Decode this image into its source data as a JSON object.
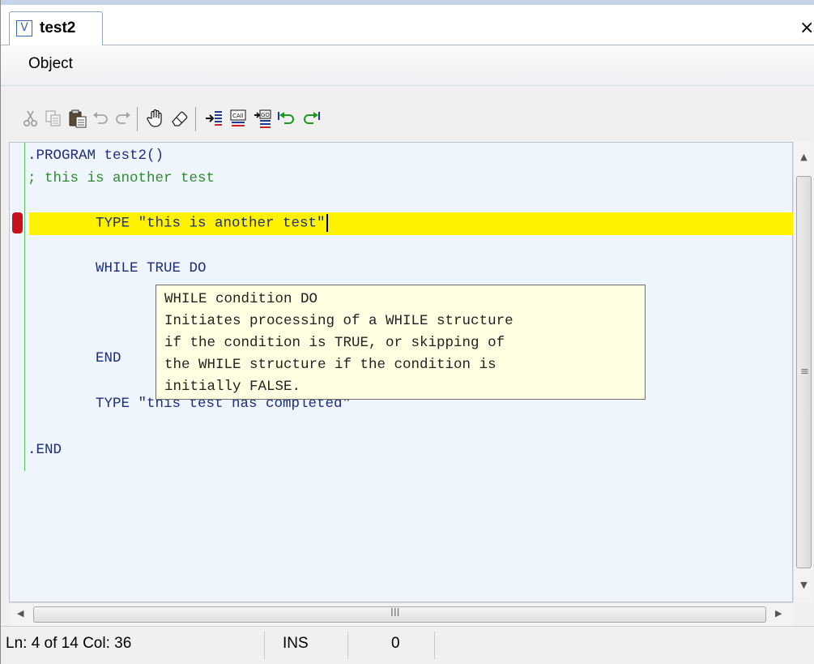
{
  "window": {
    "tab_icon_glyph": "V",
    "tab_title": "test2",
    "close_glyph": "×"
  },
  "menu": {
    "items": [
      "Object"
    ]
  },
  "toolbar": {
    "buttons": [
      {
        "icon": "cut-icon",
        "enabled": false
      },
      {
        "icon": "copy-icon",
        "enabled": false
      },
      {
        "icon": "paste-icon",
        "enabled": true
      },
      {
        "icon": "undo-icon",
        "enabled": false
      },
      {
        "icon": "redo-icon",
        "enabled": false
      },
      {
        "icon": "hand-icon",
        "enabled": true
      },
      {
        "icon": "eraser-icon",
        "enabled": true
      },
      {
        "icon": "step-into-icon",
        "enabled": true
      },
      {
        "icon": "call-icon",
        "enabled": true
      },
      {
        "icon": "go-icon",
        "enabled": true
      },
      {
        "icon": "step-back-icon",
        "enabled": true
      },
      {
        "icon": "step-forward-icon",
        "enabled": true
      }
    ]
  },
  "editor": {
    "lines": [
      ".PROGRAM test2()",
      "; this is another test",
      "",
      "        TYPE \"this is another test\"",
      "",
      "        WHILE TRUE DO",
      "",
      "",
      "        END",
      "        TYPE \"this test has completed\"",
      "",
      ".END"
    ],
    "current_line_index": 3,
    "breakpoint_line_index": 3,
    "colors": {
      "keyword": "#1f2d7a",
      "comment": "#2f8a2f",
      "highlight": "#fff200",
      "breakpoint": "#c8121b",
      "background": "#eef5fc"
    }
  },
  "tooltip": {
    "lines": [
      "WHILE condition DO",
      "Initiates processing of a WHILE structure",
      "if the condition is TRUE, or skipping of",
      "the WHILE structure if the condition is",
      "initially FALSE."
    ]
  },
  "scrollbars": {
    "up_glyph": "▲",
    "down_glyph": "▼",
    "left_glyph": "◀",
    "right_glyph": "▶",
    "v_grip": "≡",
    "h_grip": "III"
  },
  "status": {
    "position": "Ln: 4 of 14  Col: 36",
    "mode": "INS",
    "value": "0"
  }
}
